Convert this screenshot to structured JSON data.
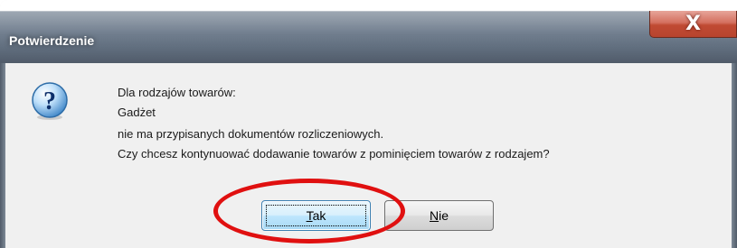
{
  "dialog": {
    "title": "Potwierdzenie",
    "close_symbol": "X",
    "icon": "question-icon",
    "message_lines": [
      "Dla rodzajów towarów:",
      "Gadżet",
      "nie ma przypisanych dokumentów rozliczeniowych.",
      "Czy chcesz kontynuować dodawanie towarów z pominięciem towarów z rodzajem?"
    ],
    "buttons": {
      "yes": {
        "accel": "T",
        "rest": "ak"
      },
      "no": {
        "accel": "N",
        "rest": "ie"
      }
    }
  },
  "annotation": {
    "color": "#e01010",
    "target": "yes-button"
  },
  "colors": {
    "title_text": "#ffffff",
    "close_button": "#c04a33",
    "focus_button": "#bee6fd"
  }
}
